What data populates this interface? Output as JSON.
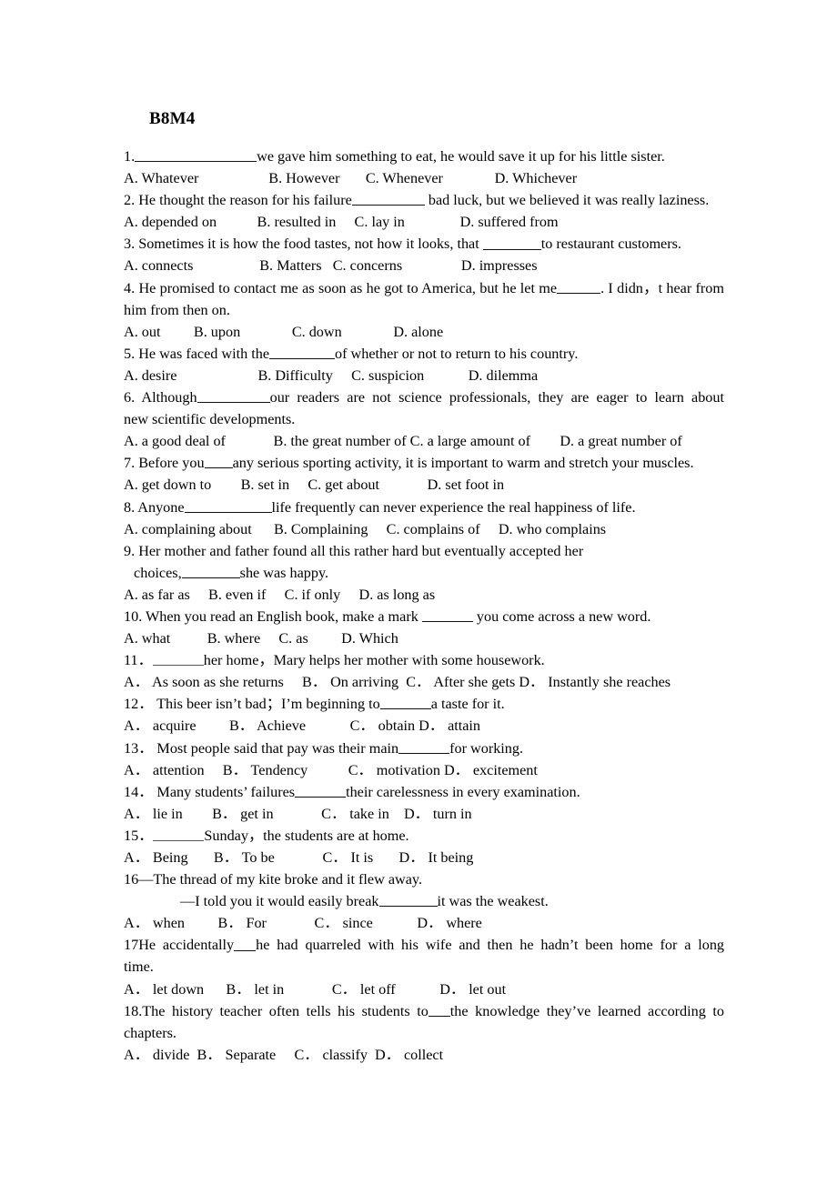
{
  "document": {
    "title": "B8M4",
    "questions": [
      {
        "id": "q1",
        "stem_before": "1.",
        "stem_blank": "w17",
        "stem_after": "we gave him something to eat, he would save it up for his little sister.",
        "options_line": "A. Whatever                   B. However       C. Whenever              D. Whichever"
      },
      {
        "id": "q2",
        "stem_before": "2. He thought the reason for his failure",
        "stem_blank": "w10",
        "stem_after": " bad luck, but we believed it was really laziness.",
        "options_line": "A. depended on           B. resulted in     C. lay in               D. suffered from"
      },
      {
        "id": "q3",
        "stem_before": "3. Sometimes it is how the food tastes, not how it looks, that ",
        "stem_blank": "w8",
        "stem_after": "to restaurant customers.",
        "options_line": "A. connects                  B. Matters   C. concerns                D. impresses"
      },
      {
        "id": "q4",
        "stem_part1": "4. He promised to contact me as soon as he got to America, but he let me",
        "stem_blank": "w6",
        "stem_part2": ". I didn，t hear from",
        "stem_wrap": "him from then on.",
        "options_line": "A. out         B. upon              C. down              D. alone"
      },
      {
        "id": "q5",
        "stem_before": "5. He was faced with the",
        "stem_blank": "w9",
        "stem_after": "of whether or not to return to his country.",
        "options_line": "A. desire                      B. Difficulty     C. suspicion            D. dilemma"
      },
      {
        "id": "q6",
        "stem_part1": "6. Although",
        "stem_blank": "w10",
        "stem_part2": "our readers are not science professionals, they are eager to learn about",
        "stem_wrap": "new scientific developments.",
        "options_line": "A. a good deal of             B. the great number of C. a large amount of        D. a great number of"
      },
      {
        "id": "q7",
        "stem_before": "7. Before you",
        "stem_blank": "w4",
        "stem_after": "any serious sporting activity, it is important to warm and stretch your muscles.",
        "options_line": "A. get down to        B. set in     C. get about             D. set foot in"
      },
      {
        "id": "q8",
        "stem_before": "8. Anyone",
        "stem_blank": "w12",
        "stem_after": "life frequently can never experience the real happiness of life.",
        "options_line": "A. complaining about      B. Complaining     C. complains of     D. who complains"
      },
      {
        "id": "q9",
        "stem_line1": "9. Her mother and father found all this rather hard but eventually accepted her",
        "stem_wrap_before": " choices,",
        "stem_blank": "w8",
        "stem_wrap_after": "she was happy.",
        "options_line": "A. as far as     B. even if     C. if only     D. as long as"
      },
      {
        "id": "q10",
        "stem_before": "10. When you read an English book, make a mark ",
        "stem_blank": "w7",
        "stem_after": " you come across a new word.",
        "options_line": "A. what          B. where     C. as         D. Which"
      },
      {
        "id": "q11",
        "stem_before": "11．",
        "stem_blank": "w7",
        "stem_after": "her home，Mary helps her mother with some housework.",
        "options_line": "A． As soon as she returns     B． On arriving  C． After she gets D． Instantly she reaches"
      },
      {
        "id": "q12",
        "stem_before": "12． This beer isn’t bad；I’m beginning to",
        "stem_blank": "w7",
        "stem_after": "a taste for it.",
        "options_line": "A． acquire         B． Achieve            C． obtain D． attain"
      },
      {
        "id": "q13",
        "stem_before": "13． Most people said that pay was their main",
        "stem_blank": "w7",
        "stem_after": "for working.",
        "options_line": "A． attention     B． Tendency           C． motivation D． excitement"
      },
      {
        "id": "q14",
        "stem_before": "14． Many students’ failures",
        "stem_blank": "w7",
        "stem_after": "their carelessness in every examination.",
        "options_line": "A． lie in        B． get in             C． take in    D． turn in"
      },
      {
        "id": "q15",
        "stem_before": "15．",
        "stem_blank": "w7",
        "stem_after": "Sunday，the students are at home.",
        "options_line": "A． Being       B． To be             C． It is       D． It being"
      },
      {
        "id": "q16",
        "stem_line1": "16—The thread of my kite broke and it flew away.",
        "stem_wrap_before": "—I told you it would easily break",
        "stem_blank": "w8",
        "stem_wrap_after": "it was the weakest.",
        "options_line": "A． when         B． For             C． since            D． where"
      },
      {
        "id": "q17",
        "stem_part1": "17He accidentally",
        "stem_blank": "w3",
        "stem_part2": "he had quarreled with his wife and then he hadn’t been home for a long",
        "stem_wrap": "time.",
        "options_line": "A． let down      B． let in             C． let off            D． let out"
      },
      {
        "id": "q18",
        "stem_part1": "18.The history teacher often tells his students to",
        "stem_blank": "w3",
        "stem_part2": "the knowledge they’ve learned according to",
        "stem_wrap": "chapters.",
        "options_line": "A． divide  B． Separate     C． classify  D． collect"
      }
    ]
  }
}
